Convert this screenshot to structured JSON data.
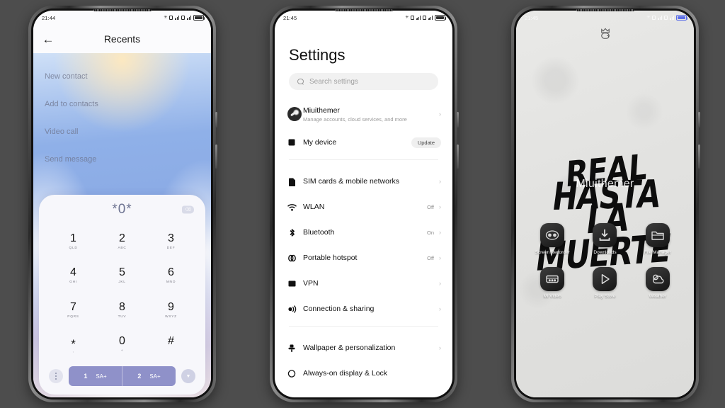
{
  "background_color": "#4d4d4d",
  "phones": {
    "dialer": {
      "status": {
        "time": "21:44"
      },
      "topbar": {
        "back_icon": "arrow-left-icon",
        "title": "Recents"
      },
      "context_menu": [
        {
          "label": "New contact"
        },
        {
          "label": "Add to contacts"
        },
        {
          "label": "Video call"
        },
        {
          "label": "Send message"
        }
      ],
      "dialpad": {
        "entered_number": "*0*",
        "backspace_icon": "backspace-icon",
        "keys": [
          {
            "digit": "1",
            "letters": "QLD"
          },
          {
            "digit": "2",
            "letters": "ABC"
          },
          {
            "digit": "3",
            "letters": "DEF"
          },
          {
            "digit": "4",
            "letters": "GHI"
          },
          {
            "digit": "5",
            "letters": "JKL"
          },
          {
            "digit": "6",
            "letters": "MNO"
          },
          {
            "digit": "7",
            "letters": "PQRS"
          },
          {
            "digit": "8",
            "letters": "TUV"
          },
          {
            "digit": "9",
            "letters": "WXYZ"
          },
          {
            "digit": "*",
            "letters": ","
          },
          {
            "digit": "0",
            "letters": "+"
          },
          {
            "digit": "#",
            "letters": ""
          }
        ],
        "more_icon": "more-vertical-icon",
        "call_buttons": [
          {
            "sim": "1",
            "label": "SA+"
          },
          {
            "sim": "2",
            "label": "SA+"
          }
        ],
        "collapse_icon": "chevron-down-icon",
        "call_button_color": "#8f91c9"
      }
    },
    "settings": {
      "status": {
        "time": "21:45"
      },
      "title": "Settings",
      "search": {
        "placeholder": "Search settings",
        "icon": "search-icon"
      },
      "account": {
        "name": "Miuithemer",
        "subtitle": "Manage accounts, cloud services, and more",
        "avatar_icon": "avatar",
        "chevron": "›"
      },
      "device": {
        "label": "My device",
        "icon": "device-icon",
        "badge": "Update"
      },
      "items": [
        {
          "label": "SIM cards & mobile networks",
          "icon": "sim-card-icon",
          "value": "",
          "chevron": "›"
        },
        {
          "label": "WLAN",
          "icon": "wifi-icon",
          "value": "Off",
          "chevron": "›"
        },
        {
          "label": "Bluetooth",
          "icon": "bluetooth-icon",
          "value": "On",
          "chevron": "›"
        },
        {
          "label": "Portable hotspot",
          "icon": "hotspot-icon",
          "value": "Off",
          "chevron": "›"
        },
        {
          "label": "VPN",
          "icon": "vpn-icon",
          "value": "",
          "chevron": "›"
        },
        {
          "label": "Connection & sharing",
          "icon": "connection-sharing-icon",
          "value": "",
          "chevron": "›"
        }
      ],
      "items2": [
        {
          "label": "Wallpaper & personalization",
          "icon": "wallpaper-icon",
          "value": "",
          "chevron": "›"
        },
        {
          "label": "Always-on display & Lock",
          "icon": "always-on-display-icon",
          "value": "",
          "chevron": ""
        }
      ]
    },
    "home": {
      "status": {
        "time": "21:45"
      },
      "logo_icon": "crown-logo-icon",
      "wallpaper_text": {
        "line1_word1": "REAL",
        "line1_word2": "HASTA",
        "line2": "LA MUERTE"
      },
      "watermark": "Miuithemer",
      "apps": [
        {
          "label": "Screen Recorder",
          "icon": "screen-recorder-icon"
        },
        {
          "label": "Downloads",
          "icon": "download-icon"
        },
        {
          "label": "File Manager",
          "icon": "folder-icon"
        },
        {
          "label": "Mi Video",
          "icon": "video-icon"
        },
        {
          "label": "Play Store",
          "icon": "play-store-icon"
        },
        {
          "label": "Weather",
          "icon": "weather-icon"
        }
      ]
    }
  }
}
